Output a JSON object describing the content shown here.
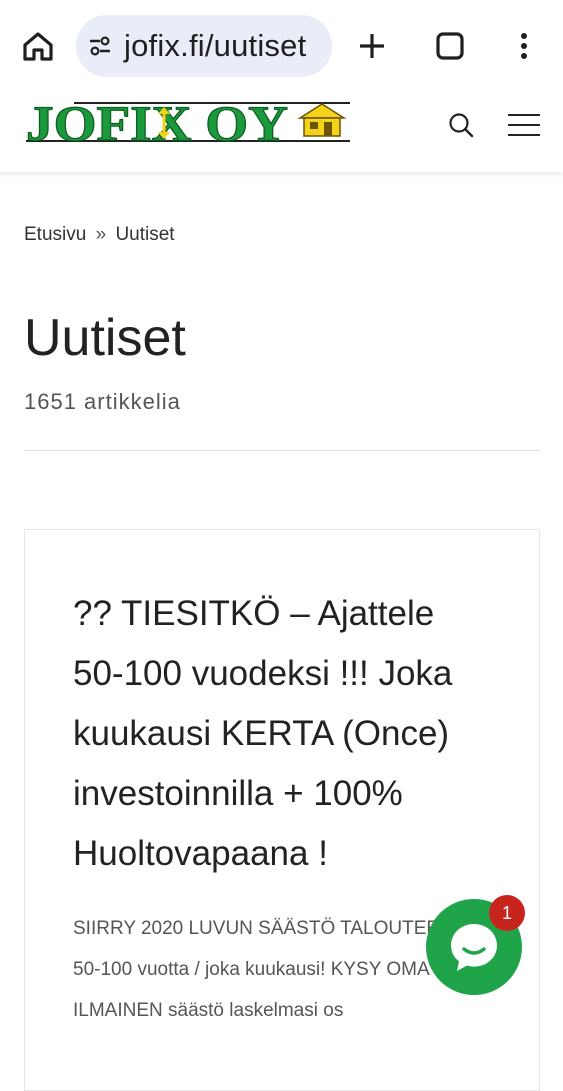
{
  "browser": {
    "url": "jofix.fi/uutiset",
    "icons": {
      "home": "home-icon",
      "site_settings": "tune-icon",
      "new_tab": "plus-icon",
      "tab_switcher": "tabs-icon",
      "menu": "more-vert-icon"
    }
  },
  "site": {
    "logo_text": "JOFIX OY",
    "icons": {
      "search": "search-icon",
      "menu": "hamburger-icon"
    },
    "colors": {
      "logo_green": "#1a9a3c",
      "logo_yellow": "#f5d21a"
    }
  },
  "breadcrumb": {
    "home": "Etusivu",
    "separator": "»",
    "current": "Uutiset"
  },
  "page": {
    "title": "Uutiset",
    "count": "1651 artikkelia"
  },
  "article": {
    "title": "?? TIESITKÖ – Ajattele 50-100 vuodeksi !!! Joka kuukausi KERTA (Once) investoinnilla + 100% Huoltovapaana !",
    "excerpt": "SIIRRY 2020 LUVUN SÄÄSTÖ TALOUTEEN jopa 50-100 vuotta / joka kuukausi! KYSY OMA ILMAINEN säästö laskelmasi os"
  },
  "chat": {
    "badge": "1",
    "icon": "chat-bubble-icon",
    "color": "#1fa44a"
  }
}
